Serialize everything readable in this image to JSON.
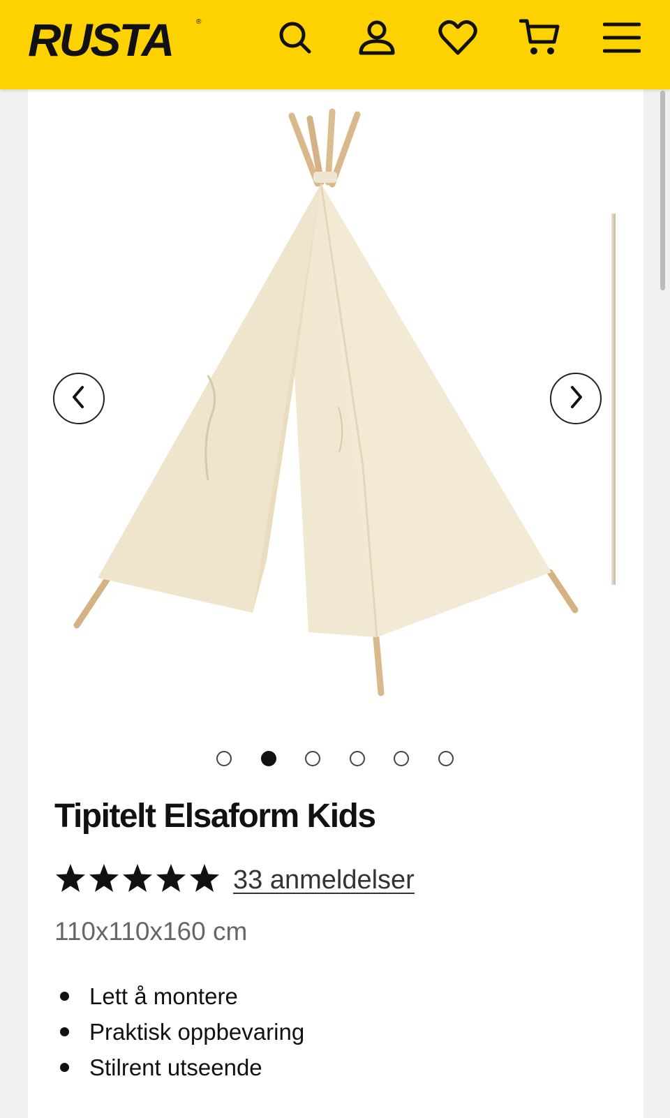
{
  "header": {
    "logo_text": "RUSTA",
    "logo_mark": "®",
    "background_color": "#fed100",
    "icons": [
      "search-icon",
      "account-icon",
      "heart-icon",
      "cart-icon",
      "menu-icon"
    ]
  },
  "gallery": {
    "product_image": "tipi-tent-image",
    "prev_icon": "chevron-left-icon",
    "next_icon": "chevron-right-icon",
    "slide_count": 6,
    "active_slide": 2
  },
  "product": {
    "title": "Tipitelt Elsaform Kids",
    "rating": 5,
    "rating_max": 5,
    "reviews_text": "33 anmeldelser",
    "dimensions": "110x110x160 cm",
    "features": [
      "Lett å montere",
      "Praktisk oppbevaring",
      "Stilrent utseende"
    ]
  }
}
